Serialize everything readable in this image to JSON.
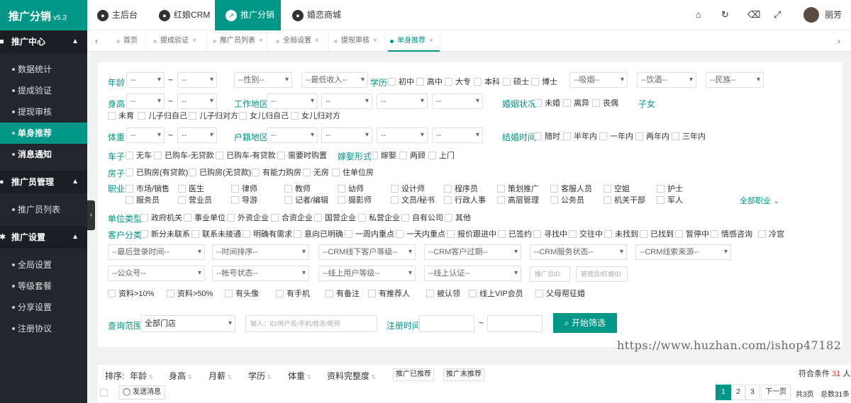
{
  "app": {
    "name": "推广分销",
    "version": "v5.3"
  },
  "topnav": [
    {
      "label": "主后台",
      "icon": "dashboard-icon"
    },
    {
      "label": "红娘CRM",
      "icon": "crm-icon"
    },
    {
      "label": "推广分销",
      "icon": "share-icon"
    },
    {
      "label": "婚恋商城",
      "icon": "shop-icon"
    }
  ],
  "user": {
    "name": "丽芳"
  },
  "sidebar": {
    "sections": [
      {
        "title": "推广中心",
        "items": [
          "数据统计",
          "提成验证",
          "提现审核",
          "单身推荐",
          "消息通知"
        ]
      },
      {
        "title": "推广员管理",
        "items": [
          "推广员列表"
        ]
      },
      {
        "title": "推广设置",
        "items": [
          "全局设置",
          "等级套餐",
          "分享设置",
          "注册协议"
        ]
      }
    ]
  },
  "tabs": [
    "首页",
    "提成验证",
    "推广员列表",
    "全局设置",
    "提现审核",
    "单身推荐"
  ],
  "filters": {
    "age": {
      "label": "年龄",
      "from": "--",
      "to": "--"
    },
    "gender": "--性别--",
    "income": "--最低收入--",
    "education": {
      "label": "学历",
      "options": [
        "初中",
        "高中",
        "大专",
        "本科",
        "硕士",
        "博士"
      ]
    },
    "smoke": "--吸烟--",
    "drink": "--饮酒--",
    "ethnic": "--民族--",
    "height": {
      "label": "身高",
      "from": "--",
      "to": "--"
    },
    "work_area": {
      "label": "工作地区",
      "values": [
        "--",
        "--",
        "--",
        "--"
      ]
    },
    "marital": {
      "label": "婚姻状况",
      "options": [
        "未婚",
        "离异",
        "丧偶"
      ]
    },
    "children": {
      "label": "子女",
      "options": [
        "未育",
        "儿子归自己",
        "儿子归对方",
        "女儿归自己",
        "女儿归对方"
      ]
    },
    "weight": {
      "label": "体重",
      "from": "--",
      "to": "--"
    },
    "hukou": {
      "label": "户籍地区",
      "values": [
        "--",
        "--",
        "--",
        "--"
      ]
    },
    "marry_time": {
      "label": "结婚时间",
      "options": [
        "随时",
        "半年内",
        "一年内",
        "两年内",
        "三年内"
      ]
    },
    "car": {
      "label": "车子",
      "options": [
        "无车",
        "已购车-无贷款",
        "已购车-有贷款",
        "需要时购置"
      ]
    },
    "marry_form": {
      "label": "嫁娶形式",
      "options": [
        "嫁娶",
        "两顾",
        "上门"
      ]
    },
    "house": {
      "label": "房子",
      "options": [
        "已购房(有贷款)",
        "已购房(无贷款)",
        "有能力购房",
        "无房",
        "住单位房"
      ]
    },
    "job": {
      "label": "职业",
      "more": "全部职业",
      "row1": [
        "市场/销售",
        "医生",
        "律师",
        "教师",
        "幼师",
        "设计师",
        "程序员",
        "策划推广",
        "客服人员",
        "空姐",
        "护士"
      ],
      "row2": [
        "服务员",
        "营业员",
        "导游",
        "记者/编辑",
        "摄影师",
        "文员/秘书",
        "行政人事",
        "高层管理",
        "公务员",
        "机关干部",
        "军人"
      ]
    },
    "unit": {
      "label": "单位类型",
      "options": [
        "政府机关",
        "事业单位",
        "外资企业",
        "合资企业",
        "国营企业",
        "私营企业",
        "自有公司",
        "其他"
      ]
    },
    "customer": {
      "label": "客户分类",
      "options": [
        "新分未联系",
        "联系未接通",
        "明确有需求",
        "意向已明确",
        "一周内重点",
        "一天内重点",
        "报价跟进中",
        "已签约",
        "寻找中",
        "交往中",
        "未找到",
        "已找到",
        "暂停中",
        "情感咨询",
        "冷宫"
      ]
    },
    "selects_row1": [
      "--最后登录时间--",
      "--时间排序--",
      "--CRM线下客户等级--",
      "--CRM客户过期--",
      "--CRM服务状态--",
      "--CRM线索来源--"
    ],
    "selects_row2": [
      "--公众号--",
      "--帐号状态--",
      "--线上用户等级--",
      "--线上认证--"
    ],
    "inputs_row2": [
      "推广员ID",
      "管理员/红娘ID"
    ],
    "flags": [
      "资料>10%",
      "资料>50%",
      "有头像",
      "有手机",
      "有备注",
      "有推荐人",
      "被认领",
      "线上VIP会员",
      "父母帮征婚"
    ],
    "scope": {
      "label": "查询范围",
      "value": "全部门店",
      "placeholder": "输入：ID/用户名/手机/姓名/昵称"
    },
    "reg_time": {
      "label": "注册时间"
    },
    "search_button": "开始筛选"
  },
  "watermark": "https://www.huzhan.com/ishop47182",
  "sort": {
    "label": "排序:",
    "fields": [
      "年龄",
      "身高",
      "月薪",
      "学历",
      "体重",
      "资料完整度"
    ],
    "buttons": [
      "推广已推荐",
      "推广未推荐"
    ]
  },
  "result": {
    "prefix": "符合条件",
    "count": "31",
    "suffix": "人"
  },
  "actions": {
    "send_message": "发送消息"
  },
  "pagination": {
    "pages": [
      "1",
      "2",
      "3"
    ],
    "next": "下一页",
    "total_pages": "共3页",
    "total_count": "总数31条"
  }
}
